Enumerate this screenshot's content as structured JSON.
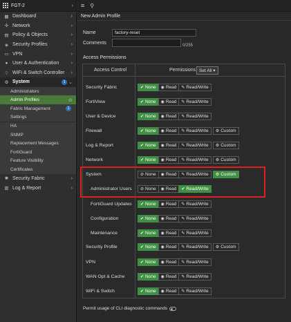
{
  "device": {
    "name": "FGT-2"
  },
  "sidebar": {
    "items": [
      {
        "label": "Dashboard",
        "icon": "dashboard-icon"
      },
      {
        "label": "Network",
        "icon": "network-icon"
      },
      {
        "label": "Policy & Objects",
        "icon": "policy-icon"
      },
      {
        "label": "Security Profiles",
        "icon": "shield-icon"
      },
      {
        "label": "VPN",
        "icon": "vpn-icon"
      },
      {
        "label": "User & Authentication",
        "icon": "user-icon"
      },
      {
        "label": "WiFi & Switch Controller",
        "icon": "wifi-icon"
      },
      {
        "label": "System",
        "icon": "gear-icon",
        "badge": "1"
      }
    ],
    "system_sub": [
      {
        "label": "Administrators"
      },
      {
        "label": "Admin Profiles"
      },
      {
        "label": "Fabric Management",
        "badge": "1"
      },
      {
        "label": "Settings"
      },
      {
        "label": "HA"
      },
      {
        "label": "SNMP"
      },
      {
        "label": "Replacement Messages"
      },
      {
        "label": "FortiGuard"
      },
      {
        "label": "Feature Visibility"
      },
      {
        "label": "Certificates"
      }
    ],
    "bottom": [
      {
        "label": "Security Fabric",
        "icon": "fabric-icon"
      },
      {
        "label": "Log & Report",
        "icon": "log-icon"
      }
    ]
  },
  "page": {
    "title": "New Admin Profile",
    "name_label": "Name",
    "name_value": "factory-reset",
    "comments_label": "Comments",
    "comments_counter": "0/255",
    "perm_section": "Access Permissions",
    "col_access": "Access Control",
    "col_perm": "Permissions",
    "set_all": "Set All",
    "cli_label": "Permit usage of CLI diagnostic commands"
  },
  "labels": {
    "none": "None",
    "read": "Read",
    "rw": "Read/Write",
    "custom": "Custom"
  },
  "rows": [
    {
      "label": "Security Fabric",
      "selected": "none",
      "custom": false
    },
    {
      "label": "FortiView",
      "selected": "none",
      "custom": false
    },
    {
      "label": "User & Device",
      "selected": "none",
      "custom": false
    },
    {
      "label": "Firewall",
      "selected": "none",
      "custom": true
    },
    {
      "label": "Log & Report",
      "selected": "none",
      "custom": true
    },
    {
      "label": "Network",
      "selected": "none",
      "custom": true
    },
    {
      "label": "System",
      "selected": "custom",
      "custom": true
    },
    {
      "label": "Administrator Users",
      "selected": "rw",
      "custom": false,
      "indent": true
    },
    {
      "label": "FortiGuard Updates",
      "selected": "none",
      "custom": false,
      "indent": true
    },
    {
      "label": "Configuration",
      "selected": "none",
      "custom": false,
      "indent": true
    },
    {
      "label": "Maintenance",
      "selected": "none",
      "custom": false,
      "indent": true
    },
    {
      "label": "Security Profile",
      "selected": "none",
      "custom": true
    },
    {
      "label": "VPN",
      "selected": "none",
      "custom": false
    },
    {
      "label": "WAN Opt & Cache",
      "selected": "none",
      "custom": false
    },
    {
      "label": "WiFi & Switch",
      "selected": "none",
      "custom": false
    }
  ],
  "colors": {
    "accent": "#3f8f44",
    "highlight": "#e02020",
    "active_nav": "#4a7a3a"
  }
}
